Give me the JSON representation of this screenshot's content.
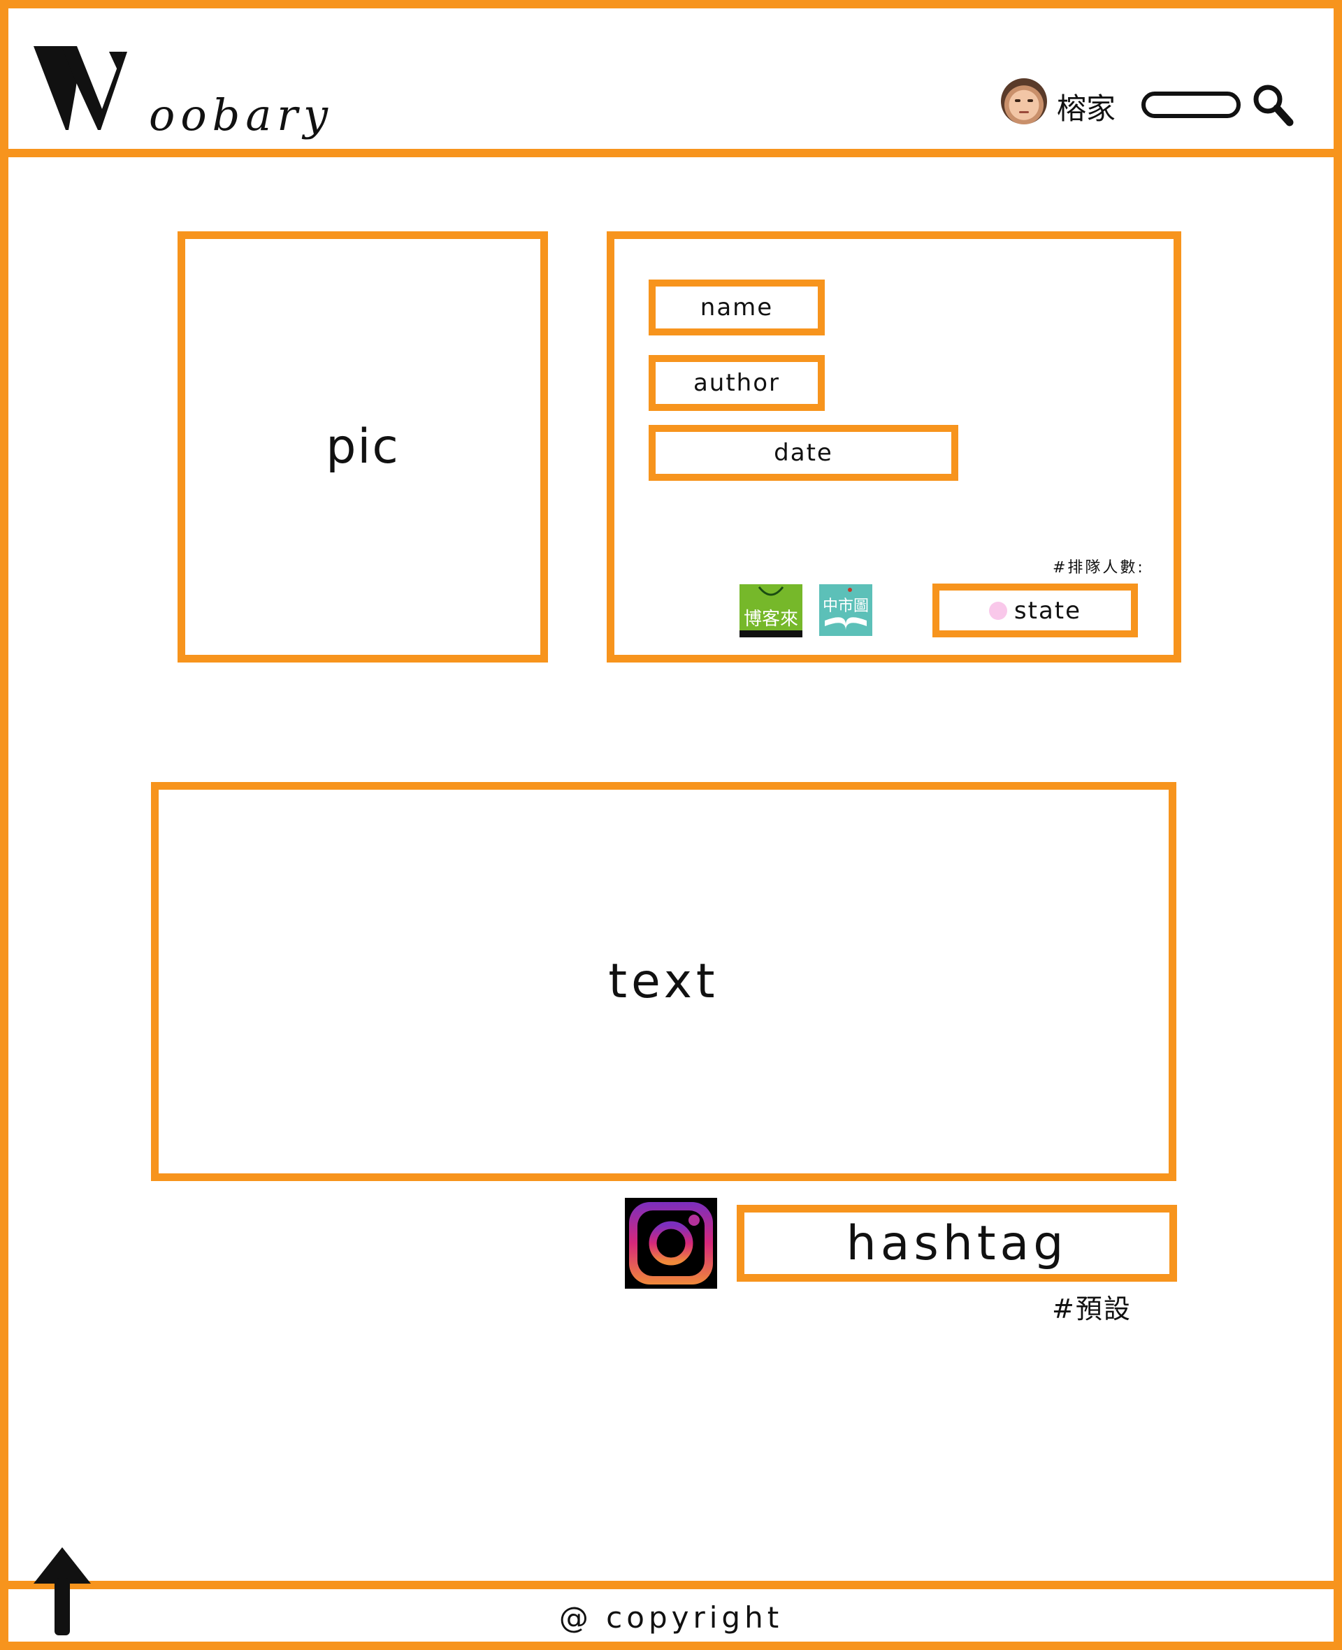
{
  "header": {
    "logo_initial": "W",
    "logo_rest": "oobary",
    "username": "榕家",
    "search": {
      "value": "",
      "placeholder": ""
    },
    "icons": {
      "avatar": "user-avatar",
      "search": "magnifier-icon"
    }
  },
  "book": {
    "pic_label": "pic",
    "name_label": "name",
    "author_label": "author",
    "date_label": "date",
    "queue_label": "#排隊人數:",
    "state_label": "state",
    "store_logos": [
      {
        "icon": "books-com-tw-logo",
        "text": "博客來"
      },
      {
        "icon": "taichung-library-logo",
        "text": "中市圖"
      }
    ],
    "state_dot_color": "#f9c8ea"
  },
  "content": {
    "text_label": "text",
    "hashtag_label": "hashtag",
    "default_tag": "#預設",
    "instagram_icon": "instagram-icon"
  },
  "footer": {
    "copyright": "@ copyright",
    "back_to_top_icon": "up-arrow-icon"
  },
  "colors": {
    "accent": "#f7941d",
    "text": "#111111"
  }
}
